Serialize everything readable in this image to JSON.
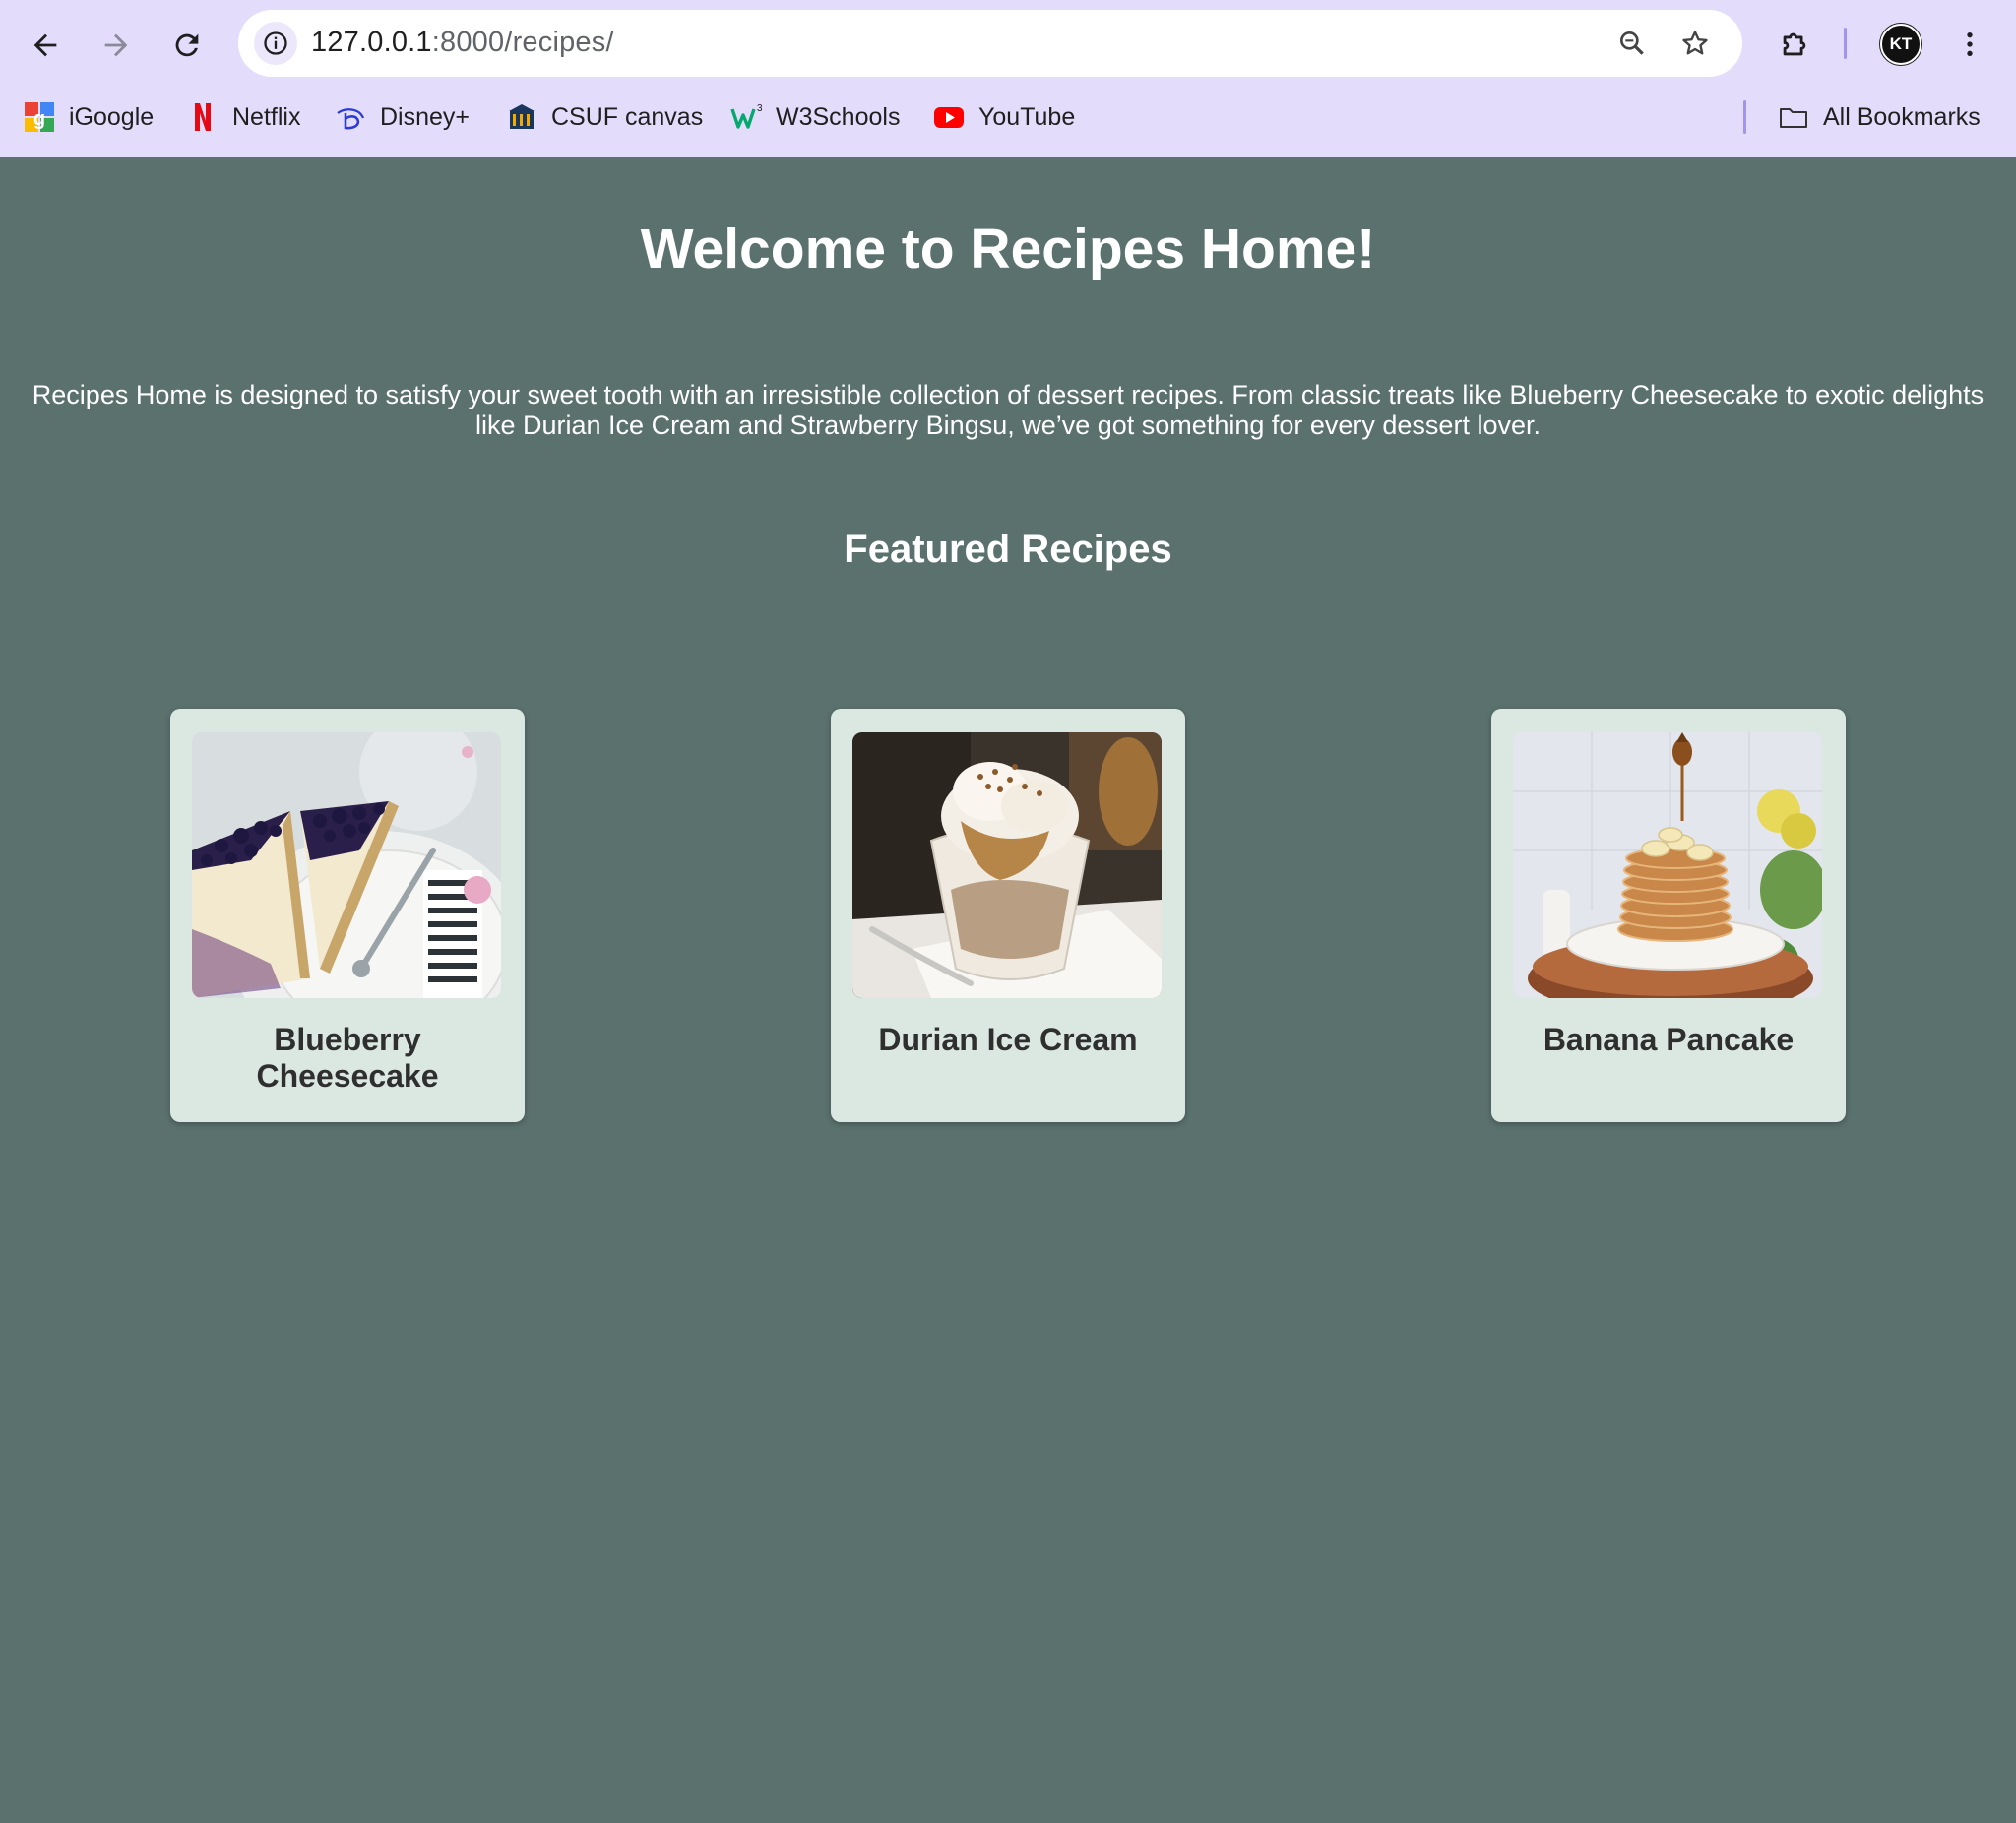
{
  "browser": {
    "url_host": "127.0.0.1",
    "url_path": ":8000/recipes/",
    "avatar_initials": "KT",
    "accent_color": "#e4dcfb",
    "bookmarks": [
      {
        "label": "iGoogle",
        "icon": "google-icon"
      },
      {
        "label": "Netflix",
        "icon": "netflix-icon"
      },
      {
        "label": "Disney+",
        "icon": "disney-icon"
      },
      {
        "label": "CSUF canvas",
        "icon": "csuf-icon"
      },
      {
        "label": "W3Schools",
        "icon": "w3schools-icon"
      },
      {
        "label": "YouTube",
        "icon": "youtube-icon"
      }
    ],
    "all_bookmarks_label": "All Bookmarks"
  },
  "page": {
    "background_color": "#5a716d",
    "title": "Welcome to Recipes Home!",
    "intro": "Recipes Home is designed to satisfy your sweet tooth with an irresistible collection of dessert recipes. From classic treats like Blueberry Cheesecake to exotic delights like Durian Ice Cream and Strawberry Bingsu, we’ve got something for every dessert lover.",
    "featured_heading": "Featured Recipes",
    "card_color": "#dbe8e2",
    "recipes": [
      {
        "name": "Blueberry Cheesecake",
        "image": "blueberry-cheesecake-photo"
      },
      {
        "name": "Durian Ice Cream",
        "image": "durian-ice-cream-photo"
      },
      {
        "name": "Banana Pancake",
        "image": "banana-pancake-photo"
      }
    ]
  }
}
